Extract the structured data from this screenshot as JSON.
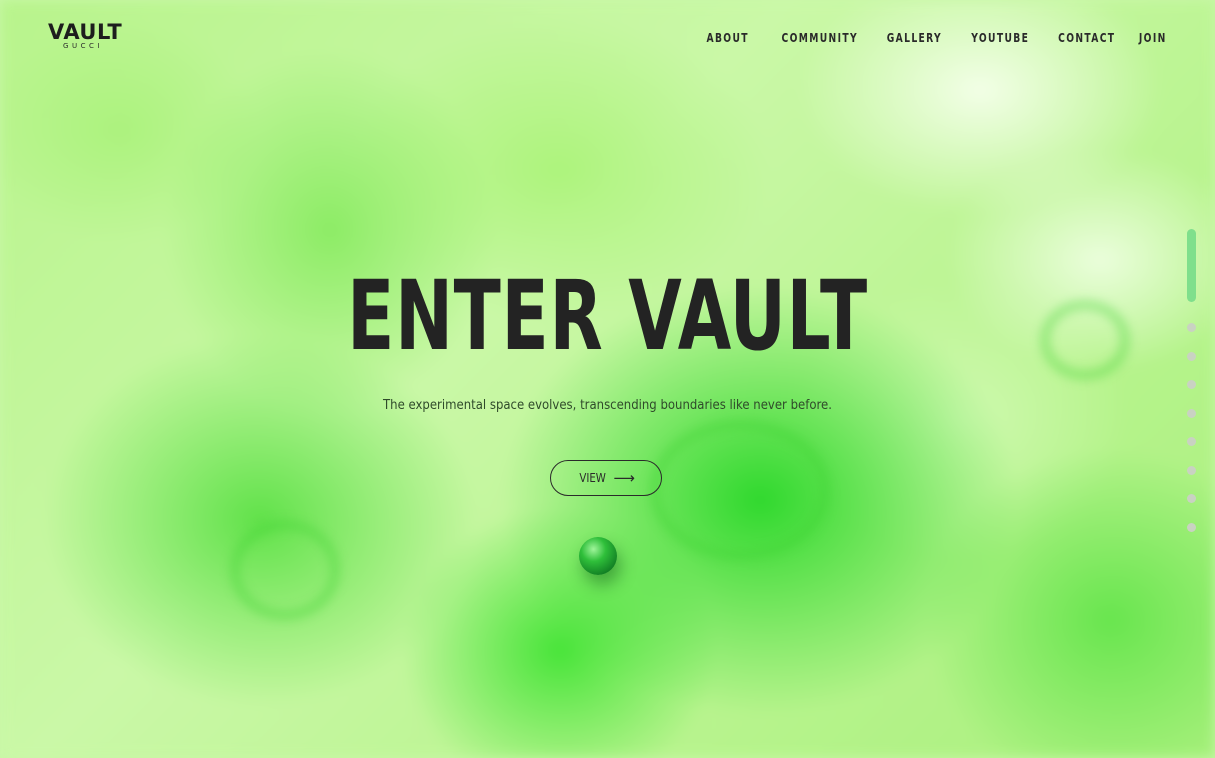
{
  "brand": {
    "name": "VAULT",
    "sub": "GUCCI"
  },
  "nav": {
    "items": [
      "ABOUT",
      "COMMUNITY",
      "GALLERY",
      "YOUTUBE",
      "CONTACT",
      "JOIN"
    ]
  },
  "hero": {
    "title": "ENTER VAULT",
    "subtitle": "The experimental space evolves, transcending boundaries like never before.",
    "button_label": "VIEW",
    "button_icon": "arrow-right-icon",
    "button_arrow": "⟶"
  },
  "pager": {
    "total": 9,
    "active": 1
  },
  "colors": {
    "text": "#232323",
    "pager_active": "#7fdf8c",
    "pager_inactive": "#c9d2c2",
    "background": "#b8f48c"
  }
}
